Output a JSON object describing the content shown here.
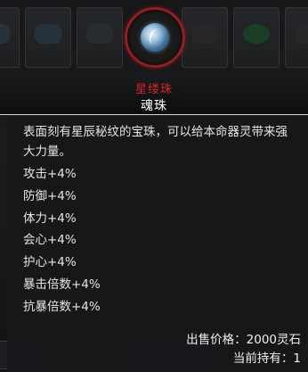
{
  "tooltip": {
    "item_name": "星缕珠",
    "item_type": "魂珠",
    "description": "表面刻有星辰秘纹的宝珠，可以给本命器灵带来强大力量。",
    "stats": [
      "攻击+4%",
      "防御+4%",
      "体力+4%",
      "会心+4%",
      "护心+4%",
      "暴击倍数+4%",
      "抗暴倍数+4%"
    ],
    "price_label": "出售价格：",
    "price_value": "2000灵石",
    "held_label": "当前持有：",
    "held_value": "1",
    "icon": "soul-pearl-icon"
  },
  "colors": {
    "item_name": "#d4252b",
    "icon_ring": "#8e1f24",
    "text": "#e4e4e4"
  }
}
